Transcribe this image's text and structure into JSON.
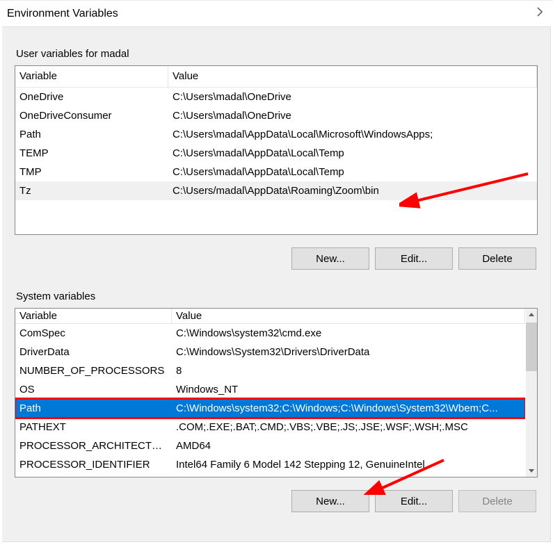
{
  "header": {
    "title": "Environment Variables"
  },
  "user_section": {
    "label": "User variables for madal",
    "col_variable": "Variable",
    "col_value": "Value",
    "rows": [
      {
        "variable": "OneDrive",
        "value": "C:\\Users\\madal\\OneDrive"
      },
      {
        "variable": "OneDriveConsumer",
        "value": "C:\\Users\\madal\\OneDrive"
      },
      {
        "variable": "Path",
        "value": "C:\\Users\\madal\\AppData\\Local\\Microsoft\\WindowsApps;"
      },
      {
        "variable": "TEMP",
        "value": "C:\\Users\\madal\\AppData\\Local\\Temp"
      },
      {
        "variable": "TMP",
        "value": "C:\\Users\\madal\\AppData\\Local\\Temp"
      },
      {
        "variable": "Tz",
        "value": "C:\\Users/madal\\AppData\\Roaming\\Zoom\\bin"
      }
    ],
    "buttons": {
      "new": "New...",
      "edit": "Edit...",
      "delete": "Delete"
    }
  },
  "system_section": {
    "label": "System variables",
    "col_variable": "Variable",
    "col_value": "Value",
    "rows": [
      {
        "variable": "ComSpec",
        "value": "C:\\Windows\\system32\\cmd.exe"
      },
      {
        "variable": "DriverData",
        "value": "C:\\Windows\\System32\\Drivers\\DriverData"
      },
      {
        "variable": "NUMBER_OF_PROCESSORS",
        "value": "8"
      },
      {
        "variable": "OS",
        "value": "Windows_NT"
      },
      {
        "variable": "Path",
        "value": "C:\\Windows\\system32;C:\\Windows;C:\\Windows\\System32\\Wbem;C..."
      },
      {
        "variable": "PATHEXT",
        "value": ".COM;.EXE;.BAT;.CMD;.VBS;.VBE;.JS;.JSE;.WSF;.WSH;.MSC"
      },
      {
        "variable": "PROCESSOR_ARCHITECTURE",
        "value": "AMD64"
      },
      {
        "variable": "PROCESSOR_IDENTIFIER",
        "value": "Intel64 Family 6 Model 142 Stepping 12, GenuineIntel"
      }
    ],
    "selected_index": 4,
    "buttons": {
      "new": "New...",
      "edit": "Edit...",
      "delete": "Delete"
    }
  }
}
